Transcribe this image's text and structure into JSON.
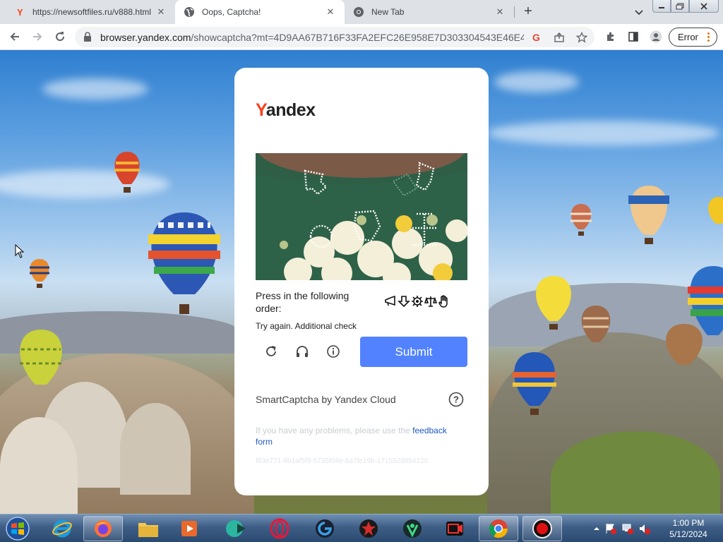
{
  "browser": {
    "tabs": [
      {
        "title": "https://newsoftfiles.ru/v888.html",
        "favicon": "yandex-icon",
        "active": false
      },
      {
        "title": "Oops, Captcha!",
        "favicon": "globe-icon",
        "active": true
      },
      {
        "title": "New Tab",
        "favicon": "chrome-icon",
        "active": false
      }
    ],
    "address": {
      "host": "browser.yandex.com",
      "path": "/showcaptcha?mt=4D9AA67B716F33FA2EFC26E958E7D303304543E46E4C..."
    },
    "profile_status": "Error"
  },
  "captcha": {
    "logo_y": "Y",
    "logo_rest": "andex",
    "instruction": "Press in the following order:",
    "order_icons": [
      "megaphone-icon",
      "arrow-down-icon",
      "gear-icon",
      "scale-icon",
      "hand-icon"
    ],
    "retry_message": "Try again. Additional check",
    "submit_label": "Submit",
    "provider": "SmartCaptcha by Yandex Cloud",
    "problems_text": "If you have any problems, please use the ",
    "feedback_link": "feedback form",
    "request_id": "f83e771-8b1af5f9-5735f04e-6a7fe19b-1715529854120"
  },
  "taskbar": {
    "apps": [
      "internet-explorer-icon",
      "firefox-icon",
      "file-explorer-icon",
      "media-player-icon",
      "app-icon",
      "opera-icon",
      "app-icon",
      "app-icon",
      "app-icon",
      "screen-recorder-icon",
      "chrome-icon",
      "record-icon"
    ],
    "time": "1:00 PM",
    "date": "5/12/2024"
  },
  "colors": {
    "yandex_red": "#fc3f1d",
    "submit_blue": "#5282ff",
    "link_blue": "#1f59c5"
  }
}
